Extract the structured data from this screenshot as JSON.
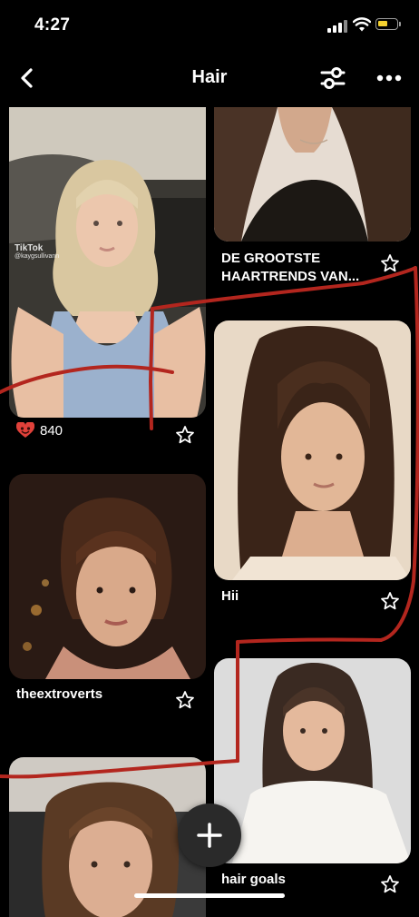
{
  "status_bar": {
    "time": "4:27",
    "battery_color": "#f4d12f"
  },
  "header": {
    "title": "Hair",
    "back_icon": "chevron-left-icon",
    "filter_icon": "sliders-icon",
    "more_icon": "ellipsis-icon"
  },
  "pins": [
    {
      "caption": "",
      "likes": "840",
      "watermark": "TikTok",
      "watermark_user": "@kaygsullivann"
    },
    {
      "caption": "DE GROOTSTE HAARTRENDS VAN..."
    },
    {
      "caption": "Hii"
    },
    {
      "caption": "theextroverts"
    },
    {
      "caption": "hair goals"
    },
    {
      "caption": ""
    }
  ],
  "fab": {
    "icon": "plus-icon"
  },
  "annotation_color": "#b3261e"
}
